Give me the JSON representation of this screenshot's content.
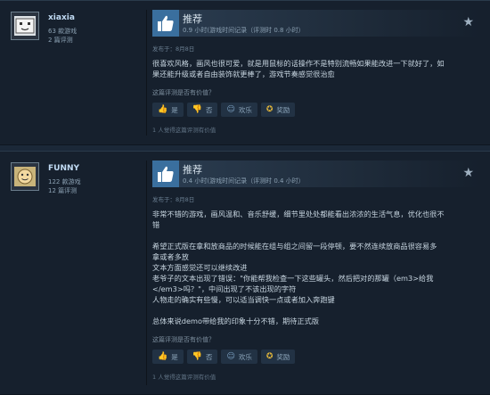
{
  "reviews": [
    {
      "author": {
        "name": "xiaxia",
        "games": "63 款游戏",
        "reviews": "2 篇评测"
      },
      "verdict": "推荐",
      "hours": "0.9 小时(游戏时间记录（评测时 0.8 小时）",
      "posted": "发布于：8月8日",
      "body": [
        "很喜欢风格，画风也很可爱，就是用鼠标的话操作不是特别流畅如果能改进一下就好了，如",
        "果还能升级或者自由装饰就更棒了，游戏节奏感觉很治愈"
      ],
      "helpful_question": "这篇评测是否有价值？",
      "buttons": {
        "yes": "是",
        "no": "否",
        "funny": "欢乐",
        "award": "奖励"
      },
      "found_helpful": "1 人觉得这篇评测有价值"
    },
    {
      "author": {
        "name": "FUNNY",
        "games": "122 款游戏",
        "reviews": "12 篇评测"
      },
      "verdict": "推荐",
      "hours": "0.4 小时(游戏时间记录（评测时 0.4 小时）",
      "posted": "发布于：8月8日",
      "body": [
        "非常不错的游戏，画风温和、音乐舒缓，细节里处处都能看出浓浓的生活气息，优化也很不",
        "错",
        "",
        "希望正式版在拿和放商品的时候能在组与组之间留一段停顿，要不然连续放商品很容易多",
        "拿或者多放",
        "文本方面感觉还可以继续改进",
        "老爷子的文本出现了错误：\"你能帮我检查一下这些罐头，然后把对的那罐（em3>给我",
        "</em3>吗？\"，中间出现了不该出现的字符",
        "人物走的确实有些慢，可以适当调快一点或者加入奔跑键",
        "",
        "总体来说demo带给我的印象十分不错，期待正式版"
      ],
      "helpful_question": "这篇评测是否有价值？",
      "buttons": {
        "yes": "是",
        "no": "否",
        "funny": "欢乐",
        "award": "奖励"
      },
      "found_helpful": "1 人觉得这篇评测有价值"
    }
  ],
  "colors": {
    "background": "#1b2838",
    "card": "#16202d",
    "thumb_box": "#3a6f9e",
    "award": "#e2b63a"
  }
}
